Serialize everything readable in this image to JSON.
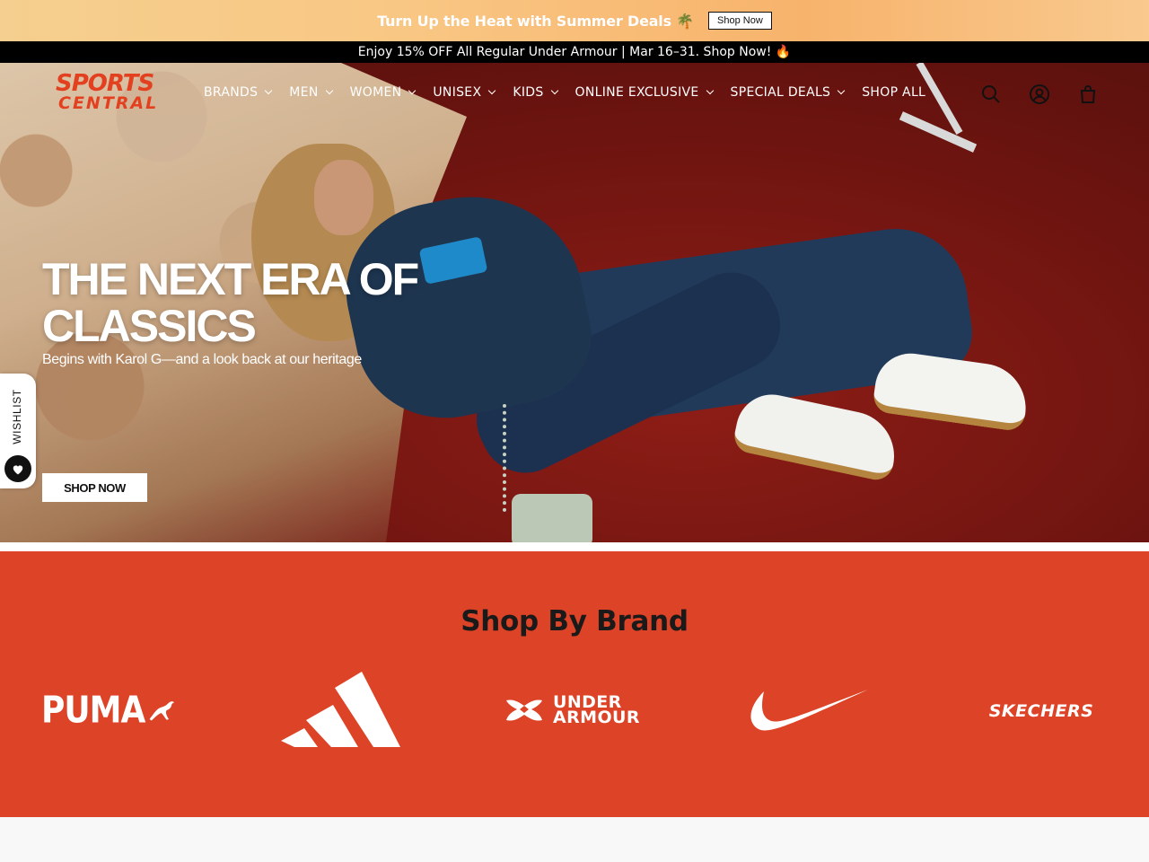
{
  "promo": {
    "text": "Turn Up the Heat with Summer Deals 🌴",
    "button": "Shop Now"
  },
  "announcement": {
    "text": "Enjoy 15% OFF All Regular Under Armour | Mar 16–31. Shop Now! 🔥"
  },
  "logo": {
    "line1": "SPORTS",
    "line2": "CENTRAL"
  },
  "nav": {
    "items": [
      {
        "label": "BRANDS",
        "has_dropdown": true
      },
      {
        "label": "MEN",
        "has_dropdown": true
      },
      {
        "label": "WOMEN",
        "has_dropdown": true
      },
      {
        "label": "UNISEX",
        "has_dropdown": true
      },
      {
        "label": "KIDS",
        "has_dropdown": true
      },
      {
        "label": "ONLINE EXCLUSIVE",
        "has_dropdown": true
      },
      {
        "label": "SPECIAL DEALS",
        "has_dropdown": true
      },
      {
        "label": "SHOP ALL",
        "has_dropdown": false
      }
    ],
    "icons": [
      "search-icon",
      "account-icon",
      "cart-icon"
    ]
  },
  "hero": {
    "title_line1": "THE NEXT ERA OF",
    "title_line2": "CLASSICS",
    "subtitle": "Begins with Karol G—and a look back at our heritage",
    "button": "SHOP NOW"
  },
  "wishlist": {
    "label": "WISHLIST"
  },
  "brands": {
    "title": "Shop By Brand",
    "items": [
      {
        "name": "PUMA",
        "wordmark": "PUMA"
      },
      {
        "name": "adidas",
        "wordmark": ""
      },
      {
        "name": "Under Armour",
        "wordmark_line1": "UNDER",
        "wordmark_line2": "ARMOUR"
      },
      {
        "name": "Nike",
        "wordmark": ""
      },
      {
        "name": "Skechers",
        "wordmark": "SKECHERS"
      }
    ]
  },
  "colors": {
    "brand_section_bg": "#dd4326",
    "logo_color": "#e2401f",
    "announcement_bg": "#000000",
    "promo_bg": "#f9c784"
  }
}
